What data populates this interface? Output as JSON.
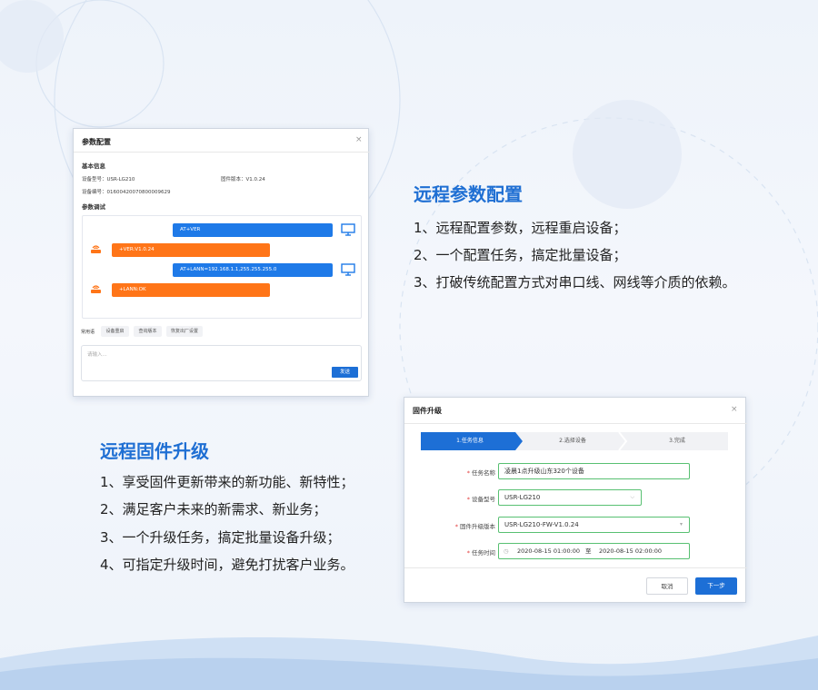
{
  "colors": {
    "accent_blue": "#1f6fd3",
    "bubble_blue": "#1f7ae8",
    "bubble_orange": "#ff7518",
    "step_active": "#1d6fd6",
    "valid_green": "#58c072"
  },
  "param_window": {
    "title": "参数配置",
    "close_icon": "close-icon",
    "basic_info_heading": "基本信息",
    "device_model": "设备型号：USR-LG210",
    "firmware_version": "固件版本：V1.0.24",
    "device_id": "设备编号：01600420070800009629",
    "debug_heading": "参数调试",
    "log": [
      {
        "type": "sent",
        "text": "AT+VER"
      },
      {
        "type": "received",
        "text": "+VER:V1.0.24"
      },
      {
        "type": "sent",
        "text": "AT+LANN=192.168.1.1,255.255.255.0"
      },
      {
        "type": "received",
        "text": "+LANN:OK"
      }
    ],
    "common_label": "常用语",
    "quick_commands": [
      "设备重启",
      "查询版本",
      "恢复出厂设置"
    ],
    "input_placeholder": "请输入...",
    "send_label": "发送"
  },
  "remote_param": {
    "title": "远程参数配置",
    "points": [
      "1、远程配置参数，远程重启设备；",
      "2、一个配置任务，搞定批量设备；",
      "3、打破传统配置方式对串口线、网线等介质的依赖。"
    ]
  },
  "remote_fw": {
    "title": "远程固件升级",
    "points": [
      "1、享受固件更新带来的新功能、新特性；",
      "2、满足客户未来的新需求、新业务；",
      "3、一个升级任务，搞定批量设备升级；",
      "4、可指定升级时间，避免打扰客户业务。"
    ]
  },
  "fw_window": {
    "title": "固件升级",
    "steps": [
      "1.任务信息",
      "2.选择设备",
      "3.完成"
    ],
    "task_name_label": "任务名称",
    "task_name_value": "凌晨1点升级山东320个设备",
    "device_model_label": "设备型号",
    "device_model_value": "USR-LG210",
    "fw_version_label": "固件升级版本",
    "fw_version_value": "USR-LG210-FW-V1.0.24",
    "task_time_label": "任务时间",
    "time_start": "2020-08-15 01:00:00",
    "time_sep": "至",
    "time_end": "2020-08-15 02:00:00",
    "cancel_label": "取消",
    "next_label": "下一步"
  }
}
